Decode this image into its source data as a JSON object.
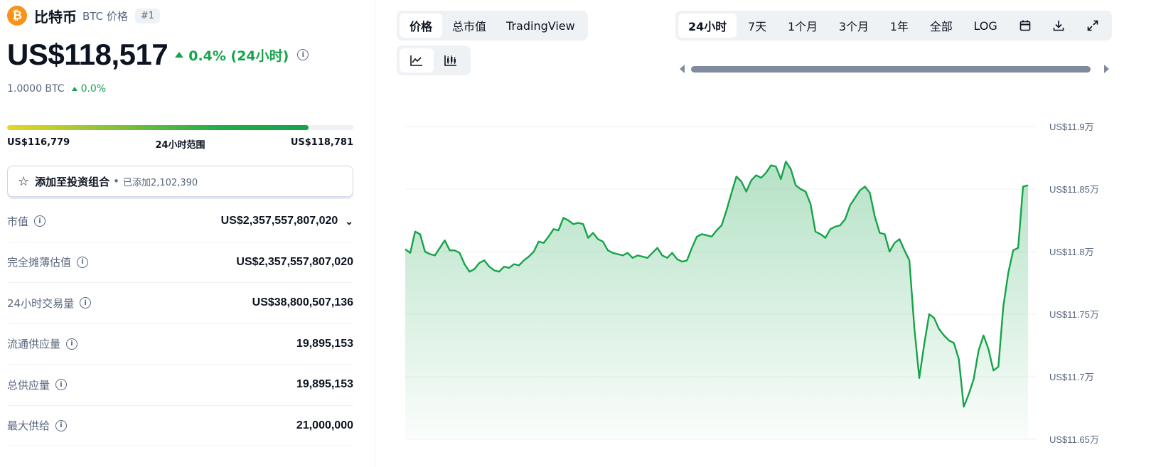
{
  "coin": {
    "logo_glyph": "₿",
    "name": "比特币",
    "symbol_label": "BTC 价格",
    "rank": "#1",
    "price": "US$118,517",
    "change_24h": "0.4% (24小时)",
    "btc_value": "1.0000 BTC",
    "btc_change": "0.0%",
    "color_up": "#16a34a",
    "logo_color": "#f7931a"
  },
  "range": {
    "low": "US$116,779",
    "label": "24小时范围",
    "high": "US$118,781",
    "position_fraction": 0.87
  },
  "portfolio": {
    "label": "添加至投资组合",
    "dot": "•",
    "count": "已添加2,102,390",
    "icon": "star-icon"
  },
  "stats": [
    {
      "label": "市值",
      "value": "US$2,357,557,807,020",
      "expandable": true
    },
    {
      "label": "完全摊薄估值",
      "value": "US$2,357,557,807,020",
      "expandable": false
    },
    {
      "label": "24小时交易量",
      "value": "US$38,800,507,136",
      "expandable": false
    },
    {
      "label": "流通供应量",
      "value": "19,895,153",
      "expandable": false
    },
    {
      "label": "总供应量",
      "value": "19,895,153",
      "expandable": false
    },
    {
      "label": "最大供给",
      "value": "21,000,000",
      "expandable": false
    }
  ],
  "chart_tabs": {
    "type_tabs": [
      "价格",
      "总市值",
      "TradingView"
    ],
    "type_active": "价格",
    "range_tabs": [
      "24小时",
      "7天",
      "1个月",
      "3个月",
      "1年",
      "全部",
      "LOG"
    ],
    "range_active": "24小时",
    "tool_icons": [
      "calendar-icon",
      "download-icon",
      "expand-icon"
    ],
    "view_icons": [
      "line-chart-icon",
      "candlestick-icon"
    ],
    "view_active": "line-chart-icon"
  },
  "chart_data": {
    "type": "area",
    "title": "",
    "xlabel": "",
    "ylabel": "",
    "yaxis_position": "right",
    "ylim": [
      116500,
      119000
    ],
    "yticks": [
      {
        "value": 119000,
        "label": "US$11.9万"
      },
      {
        "value": 118500,
        "label": "US$11.85万"
      },
      {
        "value": 118000,
        "label": "US$11.8万"
      },
      {
        "value": 117500,
        "label": "US$11.75万"
      },
      {
        "value": 117000,
        "label": "US$11.7万"
      },
      {
        "value": 116500,
        "label": "US$11.65万"
      }
    ],
    "grid": true,
    "line_color": "#16a34a",
    "series": [
      {
        "values": [
          118020,
          117990,
          118160,
          118140,
          118000,
          117980,
          117970,
          118030,
          118090,
          118010,
          118010,
          117990,
          117900,
          117840,
          117860,
          117910,
          117930,
          117880,
          117850,
          117840,
          117880,
          117870,
          117900,
          117890,
          117930,
          117960,
          118000,
          118080,
          118070,
          118120,
          118180,
          118170,
          118270,
          118250,
          118220,
          118230,
          118220,
          118110,
          118150,
          118100,
          118080,
          118010,
          117990,
          117980,
          117970,
          117990,
          117950,
          117970,
          117960,
          117950,
          117990,
          118030,
          117970,
          117950,
          117990,
          117940,
          117920,
          117930,
          118030,
          118120,
          118140,
          118130,
          118120,
          118170,
          118210,
          118330,
          118470,
          118600,
          118560,
          118480,
          118570,
          118610,
          118590,
          118630,
          118690,
          118680,
          118580,
          118720,
          118660,
          118530,
          118500,
          118480,
          118380,
          118160,
          118140,
          118110,
          118180,
          118200,
          118210,
          118260,
          118370,
          118430,
          118490,
          118520,
          118470,
          118280,
          118150,
          118140,
          118000,
          118070,
          118100,
          118010,
          117930,
          117390,
          116990,
          117260,
          117500,
          117470,
          117380,
          117330,
          117290,
          117270,
          117140,
          116760,
          116860,
          116980,
          117210,
          117330,
          117220,
          117050,
          117080,
          117560,
          117830,
          118010,
          118030,
          118520,
          118530
        ]
      }
    ]
  }
}
